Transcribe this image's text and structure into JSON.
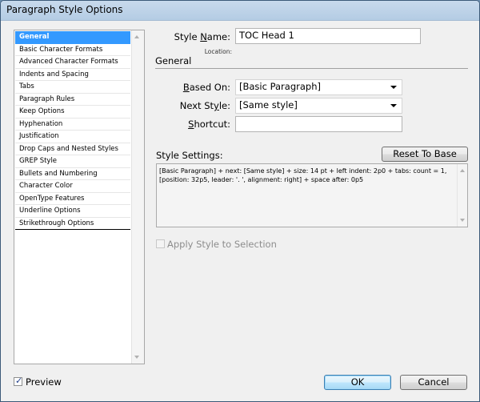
{
  "window": {
    "title": "Paragraph Style Options"
  },
  "sidebar": {
    "items": [
      {
        "label": "General",
        "selected": true
      },
      {
        "label": "Basic Character Formats"
      },
      {
        "label": "Advanced Character Formats"
      },
      {
        "label": "Indents and Spacing"
      },
      {
        "label": "Tabs"
      },
      {
        "label": "Paragraph Rules"
      },
      {
        "label": "Keep Options"
      },
      {
        "label": "Hyphenation"
      },
      {
        "label": "Justification"
      },
      {
        "label": "Drop Caps and Nested Styles"
      },
      {
        "label": "GREP Style"
      },
      {
        "label": "Bullets and Numbering"
      },
      {
        "label": "Character Color"
      },
      {
        "label": "OpenType Features"
      },
      {
        "label": "Underline Options"
      },
      {
        "label": "Strikethrough Options"
      }
    ]
  },
  "form": {
    "style_name_label_pre": "Style ",
    "style_name_label_u": "N",
    "style_name_label_post": "ame:",
    "style_name_value": "TOC Head 1",
    "location_label": "Location:",
    "section_title": "General",
    "based_on_label_u": "B",
    "based_on_label_post": "ased On:",
    "based_on_value": "[Basic Paragraph]",
    "next_style_label_pre": "Next St",
    "next_style_label_u": "y",
    "next_style_label_post": "le:",
    "next_style_value": "[Same style]",
    "shortcut_label_u": "S",
    "shortcut_label_post": "hortcut:",
    "shortcut_value": "",
    "style_settings_label": "Style Settings:",
    "reset_button": "Reset To Base",
    "style_settings_text": "[Basic Paragraph] + next: [Same style] + size: 14 pt + left indent: 2p0 + tabs: count = 1, [position: 32p5, leader: '. ', alignment: right]  + space after: 0p5",
    "apply_style_label": "Apply Style to Selection",
    "apply_style_checked": false,
    "apply_style_enabled": false
  },
  "footer": {
    "preview_label": "Preview",
    "preview_checked": true,
    "ok_button": "OK",
    "cancel_button": "Cancel"
  }
}
